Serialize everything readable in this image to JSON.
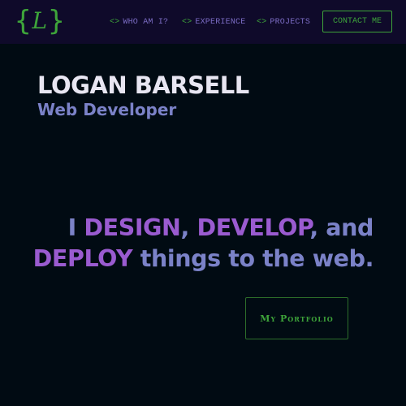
{
  "colors": {
    "background": "#010b13",
    "navbar": "#0f0a2a",
    "accent_green": "#3ea43a",
    "accent_purple": "#9a5bd0",
    "soft_blue": "#7b82c8",
    "heading": "#e8e6f2"
  },
  "header": {
    "logo": {
      "open": "{",
      "letter": "L",
      "close": "}"
    },
    "nav": [
      {
        "code": "<>",
        "label": "WHO AM I?"
      },
      {
        "code": "<>",
        "label": "EXPERIENCE"
      },
      {
        "code": "<>",
        "label": "PROJECTS"
      }
    ],
    "contact_label": "CONTACT ME"
  },
  "hero": {
    "name": "LOGAN BARSELL",
    "role": "Web Developer",
    "tagline": {
      "w1": "I ",
      "design": "DESIGN",
      "w2": ", ",
      "develop": "DEVELOP",
      "w3": ", and",
      "deploy": "DEPLOY",
      "w4": " things to the web."
    },
    "portfolio_label": "My Portfolio"
  }
}
